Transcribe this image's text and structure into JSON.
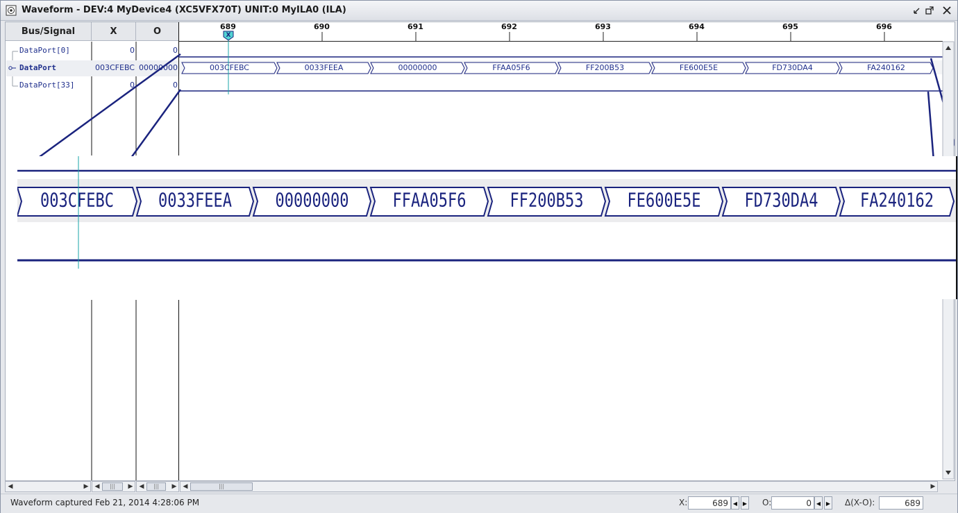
{
  "window": {
    "title": "Waveform - DEV:4 MyDevice4 (XC5VFX70T) UNIT:0 MyILA0 (ILA)"
  },
  "columns": {
    "bus_signal": "Bus/Signal",
    "x": "X",
    "o": "O"
  },
  "signals": [
    {
      "name": "DataPort[0]",
      "x": "0",
      "o": "0"
    },
    {
      "name": "DataPort",
      "x": "003CFEBC",
      "o": "00000000"
    },
    {
      "name": "DataPort[33]",
      "x": "0",
      "o": "0"
    }
  ],
  "timeline": {
    "ticks": [
      "689",
      "690",
      "691",
      "692",
      "693",
      "694",
      "695",
      "696"
    ],
    "x_cursor_label": "X"
  },
  "bus_values": [
    "003CFEBC",
    "0033FEEA",
    "00000000",
    "FFAA05F6",
    "FF200B53",
    "FE600E5E",
    "FD730DA4",
    "FA240162"
  ],
  "status": {
    "message": "Waveform captured Feb 21, 2014 4:28:06 PM",
    "x_label": "X:",
    "x_value": "689",
    "o_label": "O:",
    "o_value": "0",
    "delta_label": "Δ(X-O):",
    "delta_value": "689"
  },
  "colors": {
    "signal": "#1f2f8c",
    "cursor": "#1aa6a8",
    "zoom_line": "#1a237e"
  }
}
